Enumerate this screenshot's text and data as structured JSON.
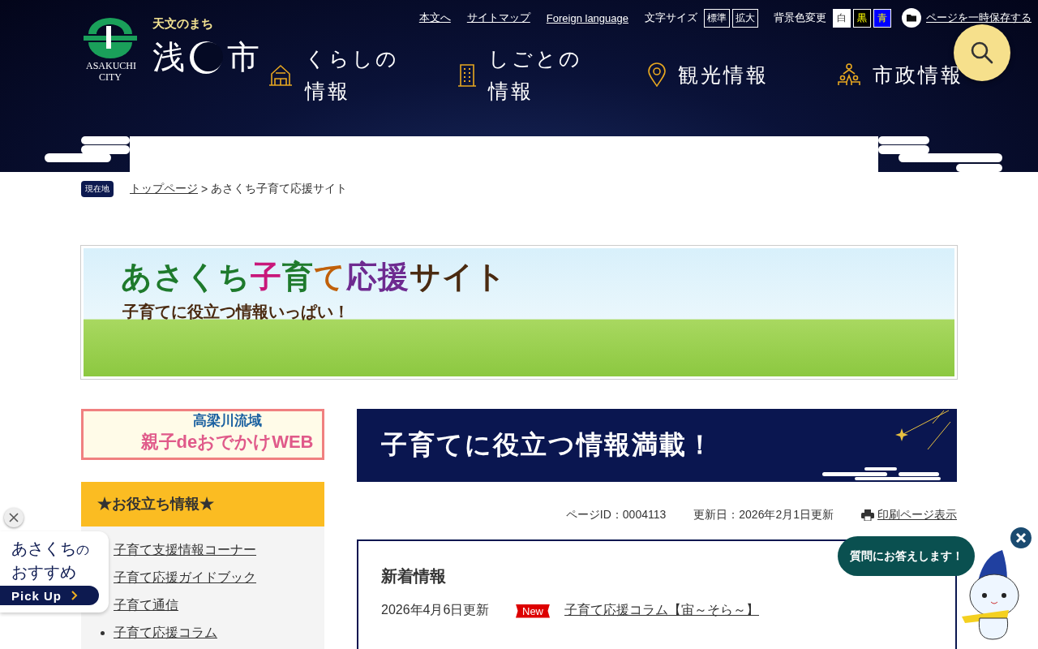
{
  "header": {
    "tagline": "天文のまち",
    "city_left": "浅",
    "city_right": "市",
    "city_en": "ASAKUCHI CITY",
    "top_links": [
      "本文へ",
      "サイトマップ",
      "Foreign language"
    ],
    "font_size": {
      "label": "文字サイズ",
      "options": [
        {
          "label": "標準",
          "selected": false
        },
        {
          "label": "拡大",
          "selected": false
        }
      ]
    },
    "bg_color": {
      "label": "背景色変更",
      "options": [
        {
          "label": "白",
          "kind": "white"
        },
        {
          "label": "黒",
          "kind": "black"
        },
        {
          "label": "青",
          "kind": "blue"
        }
      ]
    },
    "save_page": "ページを一時保存する",
    "nav": [
      {
        "label": "くらしの情報",
        "kind": "house"
      },
      {
        "label": "しごとの情報",
        "kind": "building"
      },
      {
        "label": "観光情報",
        "kind": "pin"
      },
      {
        "label": "市政情報",
        "kind": "people"
      }
    ]
  },
  "breadcrumb": {
    "badge": "現在地",
    "link": "トップページ",
    "separator": ">",
    "current": "あさくち子育て応援サイト"
  },
  "banner": {
    "title": "あさくち子育て応援サイト",
    "subtitle": "子育てに役立つ情報いっぱい！"
  },
  "side_banner": {
    "line1": "高梁川流域",
    "line2": "親子deおでかけWEB"
  },
  "side_menu": {
    "title": "★お役立ち情報★",
    "items": [
      "子育て支援情報コーナー",
      "子育て応援ガイドブック",
      "子育て通信",
      "子育て応援コラム"
    ]
  },
  "page_heading": "子育てに役立つ情報満載！",
  "meta": {
    "page_id": "ページID：0004113",
    "updated": "更新日：2026年2月1日更新",
    "print": "印刷ページ表示"
  },
  "news": {
    "title": "新着情報",
    "items": [
      {
        "date": "2026年4月6日更新",
        "badge": "New",
        "title": "子育て応援コラム【宙～そら～】"
      }
    ]
  },
  "pickup": {
    "title": "あさくち",
    "title_small": "の",
    "line2": "おすすめ",
    "button": "Pick Up"
  },
  "chat": {
    "bubble": "質問にお答えします！"
  }
}
